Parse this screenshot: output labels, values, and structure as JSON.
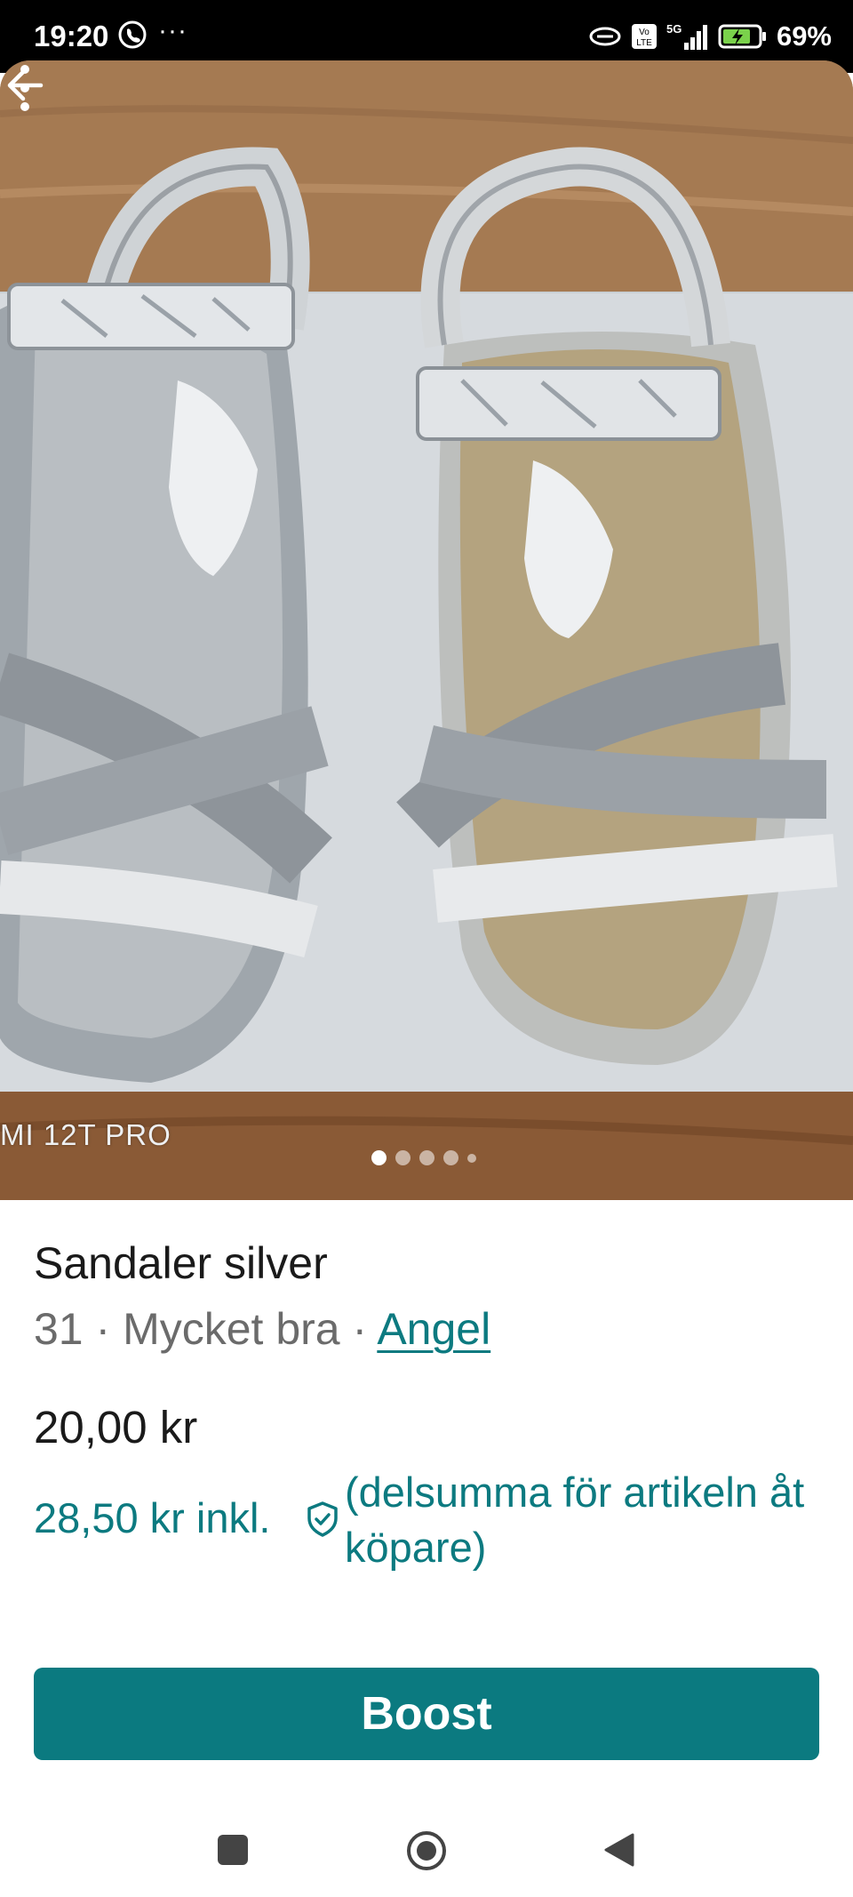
{
  "status_bar": {
    "time": "19:20",
    "more": "···",
    "battery": "69%",
    "network": "5G"
  },
  "photo": {
    "watermark": "MI 12T PRO",
    "carousel_count": 5,
    "carousel_active": 1
  },
  "listing": {
    "title": "Sandaler silver",
    "size": "31",
    "condition": "Mycket bra",
    "separator": "·",
    "brand": "Angel",
    "price": "20,00 kr",
    "incl_price": "28,50 kr",
    "incl_label": "inkl.",
    "incl_note": "(delsumma för artikeln åt köpare)"
  },
  "actions": {
    "boost_label": "Boost"
  },
  "colors": {
    "accent": "#0b7a80",
    "text": "#1a1a1a",
    "muted": "#6b6b6b"
  },
  "icons": {
    "back": "arrow-left-icon",
    "more": "more-vertical-icon",
    "shield": "shield-check-icon",
    "nav_recents": "square-icon",
    "nav_home": "circle-icon",
    "nav_back": "triangle-back-icon"
  }
}
